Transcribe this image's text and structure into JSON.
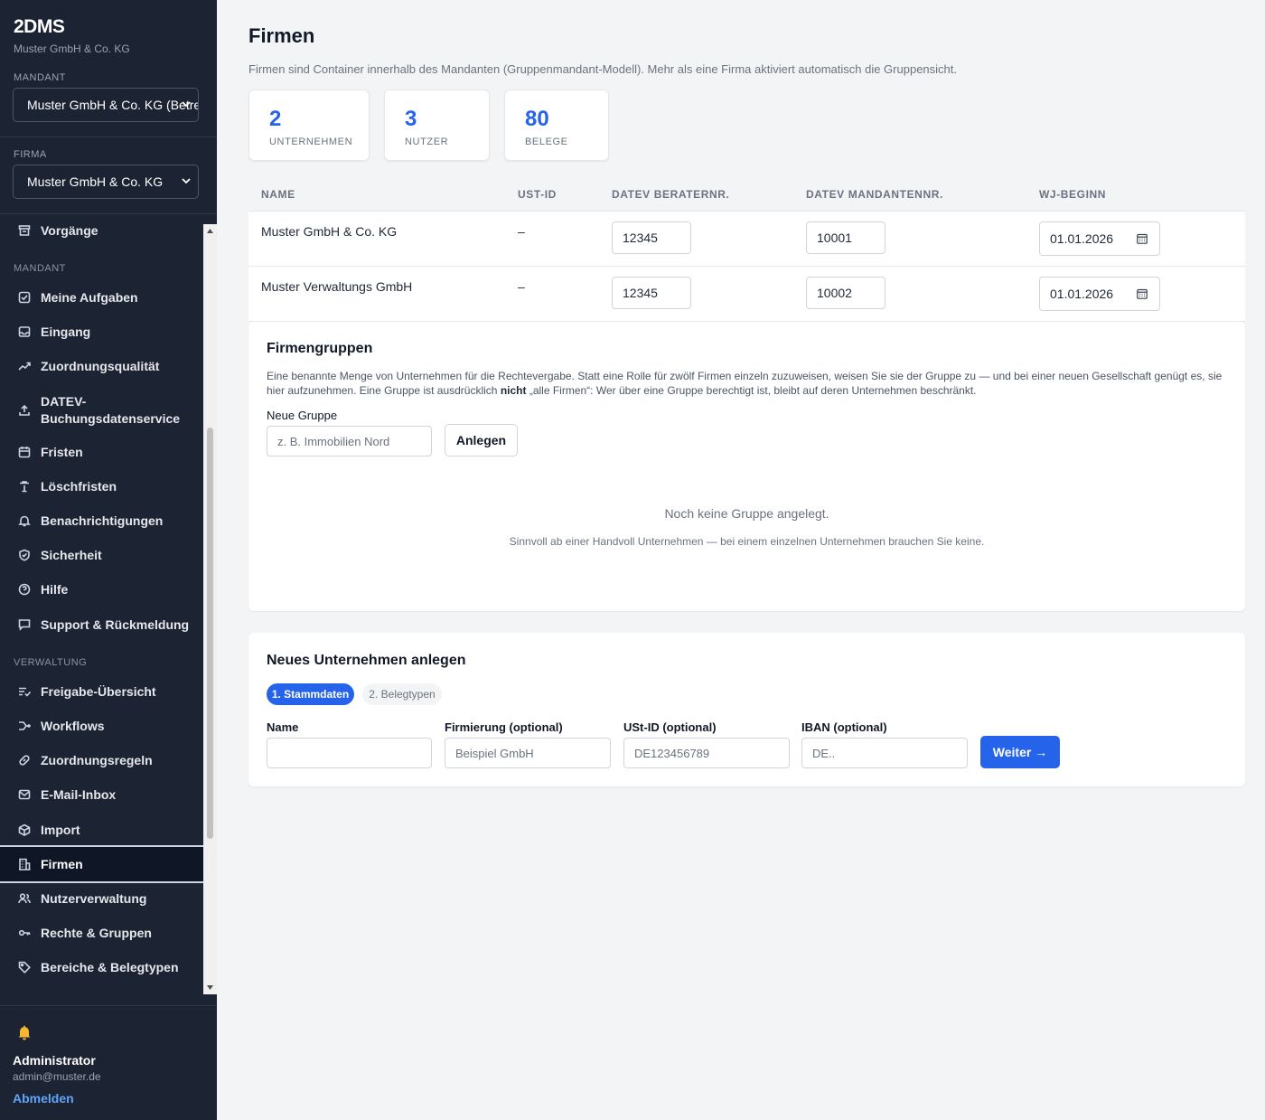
{
  "brand": {
    "name": "2DMS",
    "subtitle": "Muster GmbH & Co. KG"
  },
  "sidebar": {
    "mandant_label": "MANDANT",
    "mandant_value": "Muster GmbH & Co. KG (Betre",
    "firma_label": "FIRMA",
    "firma_value": "Muster GmbH & Co. KG",
    "top_item": {
      "label": "Vorgänge",
      "icon": "archive-icon"
    },
    "section_mandant": "MANDANT",
    "mandant_items": [
      {
        "label": "Meine Aufgaben",
        "icon": "check-square-icon"
      },
      {
        "label": "Eingang",
        "icon": "inbox-icon"
      },
      {
        "label": "Zuordnungsqualität",
        "icon": "trend-up-icon"
      },
      {
        "label": "DATEV-",
        "label2": "Buchungsdatenservice",
        "icon": "upload-icon"
      },
      {
        "label": "Fristen",
        "icon": "calendar-icon"
      },
      {
        "label": "Löschfristen",
        "icon": "trash-icon"
      },
      {
        "label": "Benachrichtigungen",
        "icon": "bell-icon"
      },
      {
        "label": "Sicherheit",
        "icon": "shield-icon"
      },
      {
        "label": "Hilfe",
        "icon": "help-circle-icon"
      },
      {
        "label": "Support & Rückmeldung",
        "icon": "message-icon"
      }
    ],
    "section_verwaltung": "VERWALTUNG",
    "verwaltung_items": [
      {
        "label": "Freigabe-Übersicht",
        "icon": "list-check-icon"
      },
      {
        "label": "Workflows",
        "icon": "workflow-icon"
      },
      {
        "label": "Zuordnungsregeln",
        "icon": "link-icon"
      },
      {
        "label": "E-Mail-Inbox",
        "icon": "mail-icon"
      },
      {
        "label": "Import",
        "icon": "package-icon"
      },
      {
        "label": "Firmen",
        "icon": "building-icon",
        "active": true
      },
      {
        "label": "Nutzerverwaltung",
        "icon": "users-icon"
      },
      {
        "label": "Rechte & Gruppen",
        "icon": "key-icon"
      },
      {
        "label": "Bereiche & Belegtypen",
        "icon": "tag-icon"
      }
    ],
    "user": {
      "name": "Administrator",
      "email": "admin@muster.de",
      "logout": "Abmelden"
    }
  },
  "main": {
    "title": "Firmen",
    "description": "Firmen sind Container innerhalb des Mandanten (Gruppenmandant-Modell). Mehr als eine Firma aktiviert automatisch die Gruppensicht.",
    "stats": [
      {
        "value": "2",
        "label": "UNTERNEHMEN"
      },
      {
        "value": "3",
        "label": "NUTZER"
      },
      {
        "value": "80",
        "label": "BELEGE"
      }
    ],
    "table": {
      "headers": [
        "NAME",
        "UST-ID",
        "DATEV BERATERNR.",
        "DATEV MANDANTENNR.",
        "WJ-BEGINN"
      ],
      "rows": [
        {
          "name": "Muster GmbH & Co. KG",
          "ust": "–",
          "berater": "12345",
          "mandant": "10001",
          "wj": "01.01.2026"
        },
        {
          "name": "Muster Verwaltungs GmbH",
          "ust": "–",
          "berater": "12345",
          "mandant": "10002",
          "wj": "01.01.2026"
        }
      ]
    },
    "groups": {
      "title": "Firmengruppen",
      "desc_part1": "Eine benannte Menge von Unternehmen für die Rechtevergabe. Statt eine Rolle für zwölf Firmen einzeln zuzuweisen, weisen Sie sie der Gruppe zu — und bei einer neuen Gesellschaft genügt es, sie hier aufzunehmen. Eine Gruppe ist ausdrücklich ",
      "desc_bold": "nicht",
      "desc_part2": " „alle Firmen“: Wer über eine Gruppe berechtigt ist, bleibt auf deren Unternehmen beschränkt.",
      "new_label": "Neue Gruppe",
      "new_placeholder": "z. B. Immobilien Nord",
      "create_button": "Anlegen",
      "empty_title": "Noch keine Gruppe angelegt.",
      "empty_sub": "Sinnvoll ab einer Handvoll Unternehmen — bei einem einzelnen Unternehmen brauchen Sie keine."
    },
    "new_company": {
      "title": "Neues Unternehmen anlegen",
      "steps": [
        "1. Stammdaten",
        "2. Belegtypen"
      ],
      "fields": [
        {
          "label": "Name",
          "placeholder": ""
        },
        {
          "label": "Firmierung (optional)",
          "placeholder": "Beispiel GmbH"
        },
        {
          "label": "USt-ID (optional)",
          "placeholder": "DE123456789"
        },
        {
          "label": "IBAN (optional)",
          "placeholder": "DE.."
        }
      ],
      "next_button": "Weiter →"
    }
  }
}
